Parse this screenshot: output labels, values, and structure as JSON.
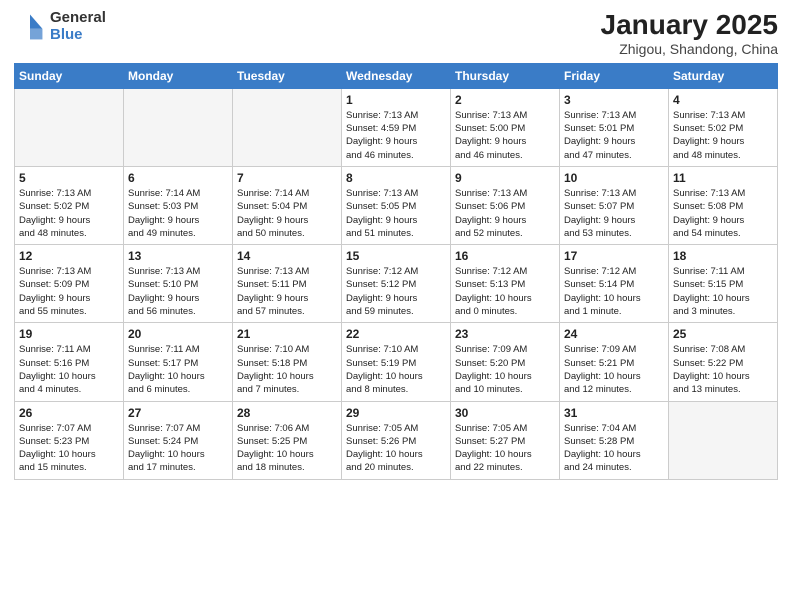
{
  "header": {
    "logo_general": "General",
    "logo_blue": "Blue",
    "title": "January 2025",
    "location": "Zhigou, Shandong, China"
  },
  "weekdays": [
    "Sunday",
    "Monday",
    "Tuesday",
    "Wednesday",
    "Thursday",
    "Friday",
    "Saturday"
  ],
  "weeks": [
    [
      {
        "day": "",
        "text": ""
      },
      {
        "day": "",
        "text": ""
      },
      {
        "day": "",
        "text": ""
      },
      {
        "day": "1",
        "text": "Sunrise: 7:13 AM\nSunset: 4:59 PM\nDaylight: 9 hours\nand 46 minutes."
      },
      {
        "day": "2",
        "text": "Sunrise: 7:13 AM\nSunset: 5:00 PM\nDaylight: 9 hours\nand 46 minutes."
      },
      {
        "day": "3",
        "text": "Sunrise: 7:13 AM\nSunset: 5:01 PM\nDaylight: 9 hours\nand 47 minutes."
      },
      {
        "day": "4",
        "text": "Sunrise: 7:13 AM\nSunset: 5:02 PM\nDaylight: 9 hours\nand 48 minutes."
      }
    ],
    [
      {
        "day": "5",
        "text": "Sunrise: 7:13 AM\nSunset: 5:02 PM\nDaylight: 9 hours\nand 48 minutes."
      },
      {
        "day": "6",
        "text": "Sunrise: 7:14 AM\nSunset: 5:03 PM\nDaylight: 9 hours\nand 49 minutes."
      },
      {
        "day": "7",
        "text": "Sunrise: 7:14 AM\nSunset: 5:04 PM\nDaylight: 9 hours\nand 50 minutes."
      },
      {
        "day": "8",
        "text": "Sunrise: 7:13 AM\nSunset: 5:05 PM\nDaylight: 9 hours\nand 51 minutes."
      },
      {
        "day": "9",
        "text": "Sunrise: 7:13 AM\nSunset: 5:06 PM\nDaylight: 9 hours\nand 52 minutes."
      },
      {
        "day": "10",
        "text": "Sunrise: 7:13 AM\nSunset: 5:07 PM\nDaylight: 9 hours\nand 53 minutes."
      },
      {
        "day": "11",
        "text": "Sunrise: 7:13 AM\nSunset: 5:08 PM\nDaylight: 9 hours\nand 54 minutes."
      }
    ],
    [
      {
        "day": "12",
        "text": "Sunrise: 7:13 AM\nSunset: 5:09 PM\nDaylight: 9 hours\nand 55 minutes."
      },
      {
        "day": "13",
        "text": "Sunrise: 7:13 AM\nSunset: 5:10 PM\nDaylight: 9 hours\nand 56 minutes."
      },
      {
        "day": "14",
        "text": "Sunrise: 7:13 AM\nSunset: 5:11 PM\nDaylight: 9 hours\nand 57 minutes."
      },
      {
        "day": "15",
        "text": "Sunrise: 7:12 AM\nSunset: 5:12 PM\nDaylight: 9 hours\nand 59 minutes."
      },
      {
        "day": "16",
        "text": "Sunrise: 7:12 AM\nSunset: 5:13 PM\nDaylight: 10 hours\nand 0 minutes."
      },
      {
        "day": "17",
        "text": "Sunrise: 7:12 AM\nSunset: 5:14 PM\nDaylight: 10 hours\nand 1 minute."
      },
      {
        "day": "18",
        "text": "Sunrise: 7:11 AM\nSunset: 5:15 PM\nDaylight: 10 hours\nand 3 minutes."
      }
    ],
    [
      {
        "day": "19",
        "text": "Sunrise: 7:11 AM\nSunset: 5:16 PM\nDaylight: 10 hours\nand 4 minutes."
      },
      {
        "day": "20",
        "text": "Sunrise: 7:11 AM\nSunset: 5:17 PM\nDaylight: 10 hours\nand 6 minutes."
      },
      {
        "day": "21",
        "text": "Sunrise: 7:10 AM\nSunset: 5:18 PM\nDaylight: 10 hours\nand 7 minutes."
      },
      {
        "day": "22",
        "text": "Sunrise: 7:10 AM\nSunset: 5:19 PM\nDaylight: 10 hours\nand 8 minutes."
      },
      {
        "day": "23",
        "text": "Sunrise: 7:09 AM\nSunset: 5:20 PM\nDaylight: 10 hours\nand 10 minutes."
      },
      {
        "day": "24",
        "text": "Sunrise: 7:09 AM\nSunset: 5:21 PM\nDaylight: 10 hours\nand 12 minutes."
      },
      {
        "day": "25",
        "text": "Sunrise: 7:08 AM\nSunset: 5:22 PM\nDaylight: 10 hours\nand 13 minutes."
      }
    ],
    [
      {
        "day": "26",
        "text": "Sunrise: 7:07 AM\nSunset: 5:23 PM\nDaylight: 10 hours\nand 15 minutes."
      },
      {
        "day": "27",
        "text": "Sunrise: 7:07 AM\nSunset: 5:24 PM\nDaylight: 10 hours\nand 17 minutes."
      },
      {
        "day": "28",
        "text": "Sunrise: 7:06 AM\nSunset: 5:25 PM\nDaylight: 10 hours\nand 18 minutes."
      },
      {
        "day": "29",
        "text": "Sunrise: 7:05 AM\nSunset: 5:26 PM\nDaylight: 10 hours\nand 20 minutes."
      },
      {
        "day": "30",
        "text": "Sunrise: 7:05 AM\nSunset: 5:27 PM\nDaylight: 10 hours\nand 22 minutes."
      },
      {
        "day": "31",
        "text": "Sunrise: 7:04 AM\nSunset: 5:28 PM\nDaylight: 10 hours\nand 24 minutes."
      },
      {
        "day": "",
        "text": ""
      }
    ]
  ]
}
